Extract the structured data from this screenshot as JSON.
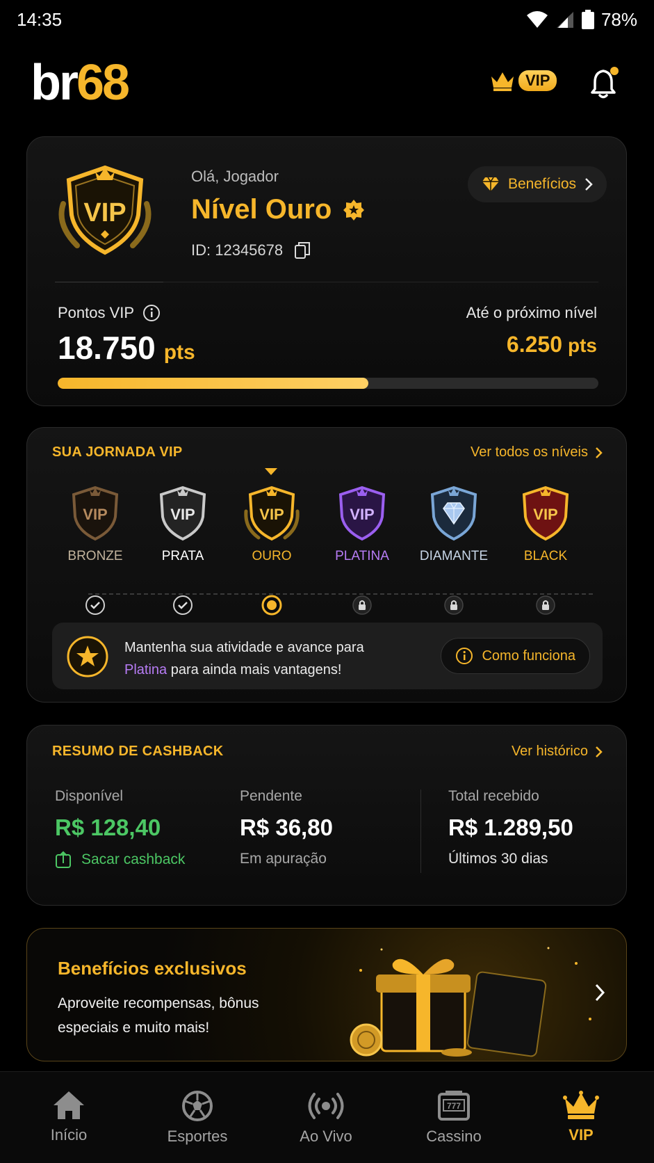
{
  "status_bar": {
    "time": "14:35",
    "battery": "78%"
  },
  "header": {
    "logo_part1": "br",
    "logo_part2": "68",
    "vip_badge": "VIP"
  },
  "profile": {
    "greeting": "Olá, Jogador",
    "level_title": "Nível Ouro",
    "player_id": "ID: 12345678",
    "benefits_label": "Benefícios",
    "points_label": "Pontos VIP",
    "points_value": "18.750",
    "points_unit": "pts",
    "next_label": "Até o próximo nível",
    "next_value": "6.250",
    "next_unit": "pts",
    "progress": 0.575
  },
  "journey": {
    "title": "SUA JORNADA VIP",
    "link": "Ver todos os níveis",
    "tiers": [
      {
        "name": "BRONZE",
        "status": "done",
        "color": "#c2b39c"
      },
      {
        "name": "PRATA",
        "status": "done",
        "color": "#ffffff"
      },
      {
        "name": "OURO",
        "status": "current",
        "color": "#f6b62b"
      },
      {
        "name": "PLATINA",
        "status": "locked",
        "color": "#b77cf5"
      },
      {
        "name": "DIAMANTE",
        "status": "locked",
        "color": "#c7d5e6"
      },
      {
        "name": "BLACK",
        "status": "locked",
        "color": "#f6b62b"
      }
    ],
    "vip_shield_text": "VIP",
    "info_text_1": "Mantenha sua atividade e avance para",
    "info_highlight": "Platina",
    "info_text_2": " para ainda mais vantagens!",
    "how_label": "Como funciona"
  },
  "cashback": {
    "title": "RESUMO DE CASHBACK",
    "link": "Ver histórico",
    "available_label": "Disponível",
    "available_value": "R$ 128,40",
    "withdraw_label": "Sacar cashback",
    "pending_label": "Pendente",
    "pending_value": "R$ 36,80",
    "pending_sub": "Em apuração",
    "total_label": "Total recebido",
    "total_value": "R$ 1.289,50",
    "total_sub": "Últimos 30 dias"
  },
  "banner": {
    "title": "Benefícios exclusivos",
    "text": "Aproveite recompensas, bônus especiais e muito mais!"
  },
  "nav": {
    "items": [
      {
        "label": "Início"
      },
      {
        "label": "Esportes"
      },
      {
        "label": "Ao Vivo"
      },
      {
        "label": "Cassino"
      },
      {
        "label": "VIP"
      }
    ]
  },
  "colors": {
    "accent": "#f6b62b",
    "success": "#4cc764",
    "platinum": "#b77cf5",
    "background": "#000000"
  }
}
